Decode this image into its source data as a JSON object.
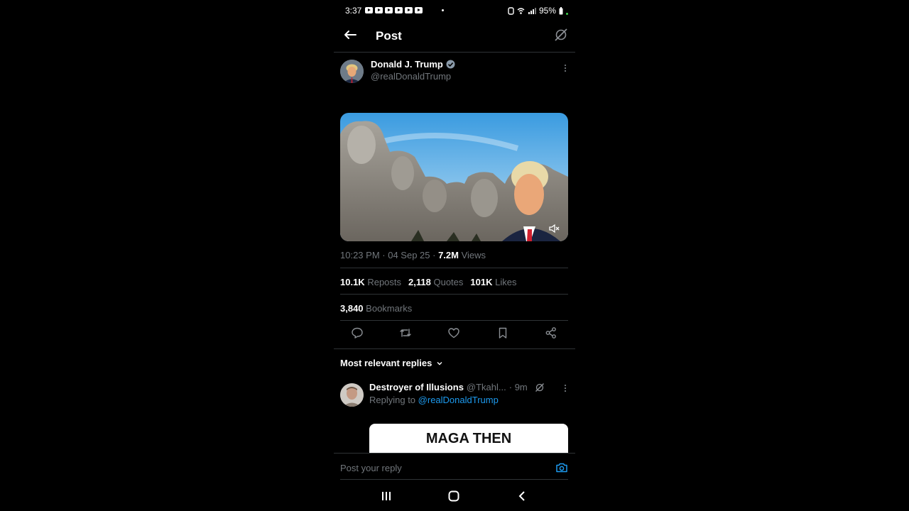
{
  "status": {
    "time": "3:37",
    "battery": "95%"
  },
  "header": {
    "back_icon": "arrow-left-icon",
    "title": "Post",
    "grok_icon": "grok-icon"
  },
  "post": {
    "author": {
      "name": "Donald J. Trump",
      "handle": "@realDonaldTrump",
      "verified": true
    },
    "media": {
      "type": "video",
      "muted": true
    },
    "meta": {
      "time": "10:23 PM",
      "date": "04 Sep 25",
      "views_count": "7.2M",
      "views_label": "Views"
    },
    "stats": {
      "reposts_count": "10.1K",
      "reposts_label": "Reposts",
      "quotes_count": "2,118",
      "quotes_label": "Quotes",
      "likes_count": "101K",
      "likes_label": "Likes",
      "bookmarks_count": "3,840",
      "bookmarks_label": "Bookmarks"
    },
    "actions": [
      "reply-icon",
      "repost-icon",
      "like-icon",
      "bookmark-icon",
      "share-icon"
    ]
  },
  "replies": {
    "sort_label": "Most relevant replies",
    "items": [
      {
        "name": "Destroyer of Illusions",
        "handle": "@Tkahl...",
        "time": "· 9m",
        "replying_prefix": "Replying to",
        "replying_to": "@realDonaldTrump",
        "image_text": "MAGA THEN"
      }
    ]
  },
  "reply_bar": {
    "placeholder": "Post your reply",
    "camera_icon": "camera-icon"
  },
  "colors": {
    "background": "#000000",
    "link": "#1d9bf0",
    "muted": "#71767b",
    "divider": "#2f3336"
  }
}
